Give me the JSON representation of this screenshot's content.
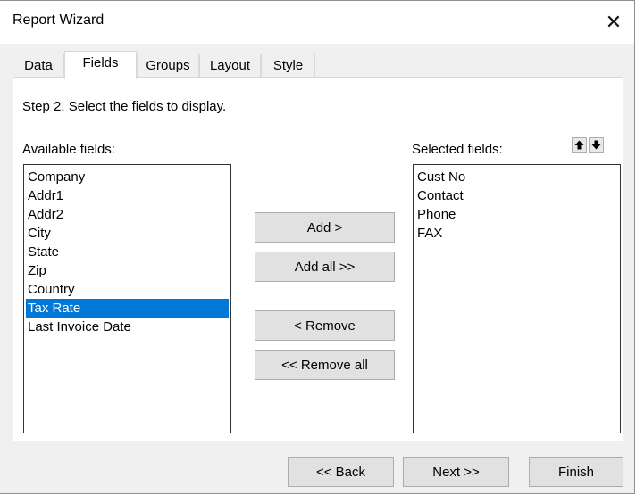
{
  "window": {
    "title": "Report Wizard"
  },
  "tabs": [
    {
      "label": "Data",
      "active": false
    },
    {
      "label": "Fields",
      "active": true
    },
    {
      "label": "Groups",
      "active": false
    },
    {
      "label": "Layout",
      "active": false
    },
    {
      "label": "Style",
      "active": false
    }
  ],
  "step_text": "Step 2. Select the fields to display.",
  "available": {
    "label": "Available fields:",
    "items": [
      "Company",
      "Addr1",
      "Addr2",
      "City",
      "State",
      "Zip",
      "Country",
      "Tax Rate",
      "Last Invoice Date"
    ],
    "selected_item": "Tax Rate"
  },
  "selected": {
    "label": "Selected fields:",
    "items": [
      "Cust No",
      "Contact",
      "Phone",
      "FAX"
    ]
  },
  "buttons": {
    "add": "Add >",
    "add_all": "Add all >>",
    "remove": "< Remove",
    "remove_all": "<< Remove all",
    "back": "<< Back",
    "next": "Next >>",
    "finish": "Finish"
  },
  "colors": {
    "selection": "#0078d7",
    "panel": "#ffffff",
    "chrome": "#f0f0f0"
  }
}
